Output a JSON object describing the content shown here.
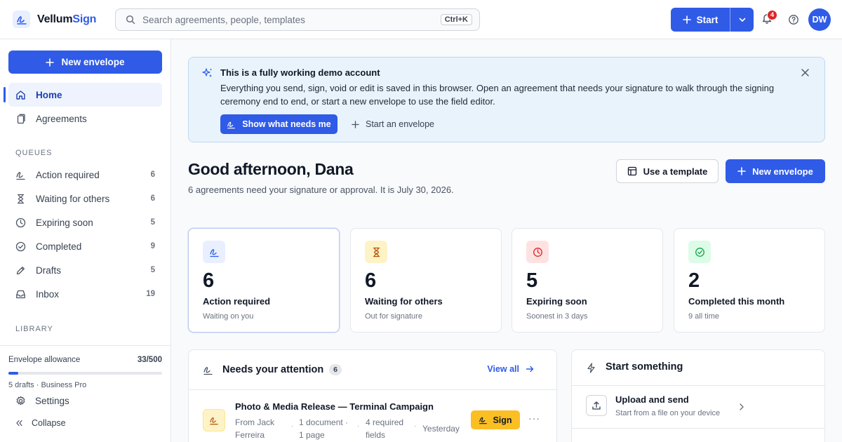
{
  "app": {
    "brand_part1": "Vellum",
    "brand_part2": "Sign"
  },
  "search": {
    "placeholder": "Search agreements, people, templates",
    "shortcut": "Ctrl+K"
  },
  "header": {
    "start_label": "Start",
    "notifications_count": "4",
    "avatar_initials": "DW"
  },
  "sidebar": {
    "new_envelope_label": "New envelope",
    "nav": [
      {
        "label": "Home",
        "icon": "home-icon",
        "active": true
      },
      {
        "label": "Agreements",
        "icon": "documents-icon"
      }
    ],
    "queues_label": "QUEUES",
    "queues": [
      {
        "label": "Action required",
        "count": "6",
        "icon": "signature-icon"
      },
      {
        "label": "Waiting for others",
        "count": "6",
        "icon": "hourglass-icon"
      },
      {
        "label": "Expiring soon",
        "count": "5",
        "icon": "clock-icon"
      },
      {
        "label": "Completed",
        "count": "9",
        "icon": "check-circle-icon"
      },
      {
        "label": "Drafts",
        "count": "5",
        "icon": "pencil-icon"
      },
      {
        "label": "Inbox",
        "count": "19",
        "icon": "inbox-icon"
      }
    ],
    "library_label": "LIBRARY",
    "allowance_label": "Envelope allowance",
    "allowance_count": "33/500",
    "allowance_fraction": 0.066,
    "plan_text": "5 drafts · Business Pro",
    "settings_label": "Settings",
    "collapse_label": "Collapse"
  },
  "demo_banner": {
    "title": "This is a fully working demo account",
    "body": "Everything you send, sign, void or edit is saved in this browser. Open an agreement that needs your signature to walk through the signing ceremony end to end, or start a new envelope to use the field editor.",
    "primary_label": "Show what needs me",
    "secondary_label": "Start an envelope"
  },
  "greeting": {
    "title": "Good afternoon, Dana",
    "subtitle": "6 agreements need your signature or approval. It is July 30, 2026.",
    "template_label": "Use a template",
    "new_envelope_label": "New envelope"
  },
  "stats": [
    {
      "number": "6",
      "label": "Action required",
      "sub": "Waiting on you",
      "icon": "signature-icon",
      "color": "#2f5be7",
      "bg": "#e8efff"
    },
    {
      "number": "6",
      "label": "Waiting for others",
      "sub": "Out for signature",
      "icon": "hourglass-icon",
      "color": "#b45309",
      "bg": "#fef3c7"
    },
    {
      "number": "5",
      "label": "Expiring soon",
      "sub": "Soonest in 3 days",
      "icon": "clock-icon",
      "color": "#dc2626",
      "bg": "#fee2e2"
    },
    {
      "number": "2",
      "label": "Completed this month",
      "sub": "9 all time",
      "icon": "check-circle-icon",
      "color": "#16a34a",
      "bg": "#dcfce7"
    }
  ],
  "attention": {
    "title": "Needs your attention",
    "count": "6",
    "view_all_label": "View all",
    "rows": [
      {
        "title": "Photo & Media Release — Terminal Campaign",
        "from": "From Jack Ferreira",
        "docs": "1 document · 1 page",
        "fields": "4 required fields",
        "when": "Yesterday",
        "action_label": "Sign",
        "more": "···"
      }
    ]
  },
  "start_something": {
    "title": "Start something",
    "items": [
      {
        "title": "Upload and send",
        "subtitle": "Start from a file on your device",
        "icon": "upload-icon"
      }
    ]
  }
}
